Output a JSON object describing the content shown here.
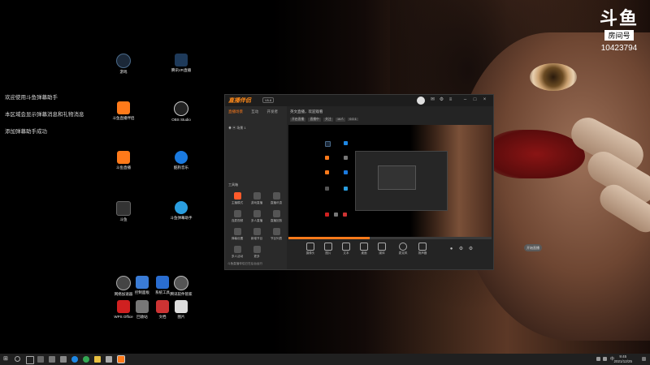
{
  "watermark": {
    "logo": "斗鱼",
    "tag": "房间号",
    "room": "10423794"
  },
  "messages": [
    "欢迎使用斗鱼弹幕助手",
    "本区域会显示弹幕消息和礼物消息",
    "添加弹幕助手成功"
  ],
  "desktop_icons": [
    {
      "label": "游戏",
      "icon": "steam-icon",
      "color": "#1b2838"
    },
    {
      "label": "斗鱼直播伴侣",
      "icon": "douyu-app-icon",
      "color": "#ff7a1a"
    },
    {
      "label": "斗鱼直播",
      "icon": "douyu-live-icon",
      "color": "#ff7a1a"
    },
    {
      "label": "斗鱼",
      "icon": "douyu-icon",
      "color": "#333333"
    },
    {
      "label": "腾讯VR直播",
      "icon": "tencent-icon",
      "color": "#1e88e5"
    },
    {
      "label": "OBS Studio",
      "icon": "obs-icon",
      "color": "#222222"
    },
    {
      "label": "酷狗音乐",
      "icon": "kugou-icon",
      "color": "#1a7ae0"
    },
    {
      "label": "斗鱼弹幕助手",
      "icon": "danmu-icon",
      "color": "#2a9ee0"
    },
    {
      "label": "网络加速器",
      "icon": "speed-icon",
      "color": "#444444"
    },
    {
      "label": "控制面板",
      "icon": "control-icon",
      "color": "#3a7bd5"
    },
    {
      "label": "系统工具",
      "icon": "tool-icon",
      "color": "#2a6dd0"
    },
    {
      "label": "腾讯软件管家",
      "icon": "manager-icon",
      "color": "#555555"
    },
    {
      "label": "WPS Office",
      "icon": "wps-icon",
      "color": "#d02020"
    },
    {
      "label": "回收站",
      "icon": "recycle-icon",
      "color": "#777777"
    },
    {
      "label": "文档",
      "icon": "doc-icon",
      "color": "#cc3333"
    },
    {
      "label": "图片",
      "icon": "image-icon",
      "color": "#dddddd"
    }
  ],
  "app": {
    "brand": "直播伴侣",
    "version": "V6.6",
    "tabs": [
      "直播场景",
      "互动",
      "开发者"
    ],
    "scene_label": "场景 1",
    "tools_header": "工具箱",
    "tools": [
      "主播模式",
      "游戏直播",
      "直播讯息",
      "连麦视频",
      "多人直播",
      "直播回放",
      "弹幕设置",
      "新增节目",
      "节目列表",
      "多人活动",
      "更多",
      ""
    ],
    "bottom_tip": "斗鱼直播伴侣已在后台运行",
    "room_title": "英文直播，欢迎观看",
    "chips": [
      "开启直播",
      "直播中",
      "关注",
      "16人",
      "0.0.1"
    ],
    "controls": [
      "摄像头",
      "图片",
      "文本",
      "桌面",
      "媒体",
      "麦克风",
      "扬声器"
    ],
    "start_label": "开始直播"
  },
  "taskbar": {
    "time": "9:45",
    "date": "2021/12/25",
    "lang": "中"
  }
}
